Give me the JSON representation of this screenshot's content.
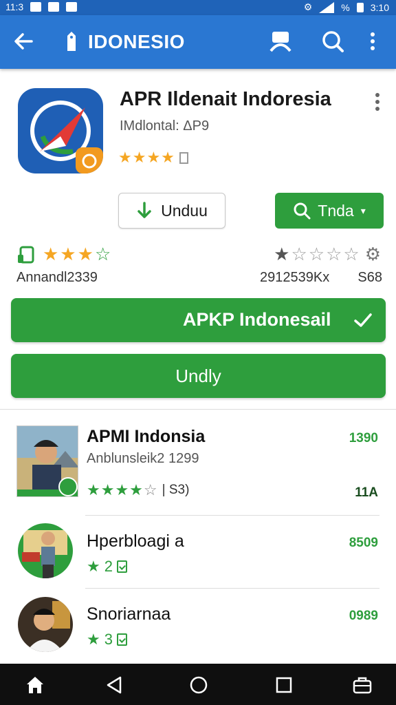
{
  "status_bar": {
    "time": "11:3",
    "battery": "%",
    "clock": "3:10"
  },
  "app_bar": {
    "title": "IDONESIO",
    "icons": [
      "back-arrow-icon",
      "tag-icon",
      "account-icon",
      "search-icon",
      "more-vert-icon"
    ]
  },
  "app": {
    "title": "APR Ildenait Indoresia",
    "subtitle": "IMdlontal: ΔP9",
    "rating_stars": 4,
    "download_label": "Unduu",
    "search_label": "Tnda"
  },
  "stats": {
    "left_label": "Annandl2339",
    "left_stars": 3,
    "right_label": "2912539Kx",
    "right_value": "S68",
    "right_stars": 1
  },
  "buttons": {
    "primary": "APKP Indonesail",
    "secondary": "Undly"
  },
  "list": [
    {
      "title": "APMI Indonsia",
      "subtitle": "Anblunsleik2 1299",
      "stars": 4,
      "note": "| S3)",
      "value": "1390",
      "value2": "11A"
    },
    {
      "title": "Hperbloagi a",
      "rating": "2",
      "value": "8509"
    },
    {
      "title": "Snoriarnaa",
      "rating": "3",
      "value": "0989"
    }
  ],
  "colors": {
    "primary_blue": "#2a77d2",
    "accent_green": "#2e9e3d",
    "star_gold": "#f5a623"
  }
}
